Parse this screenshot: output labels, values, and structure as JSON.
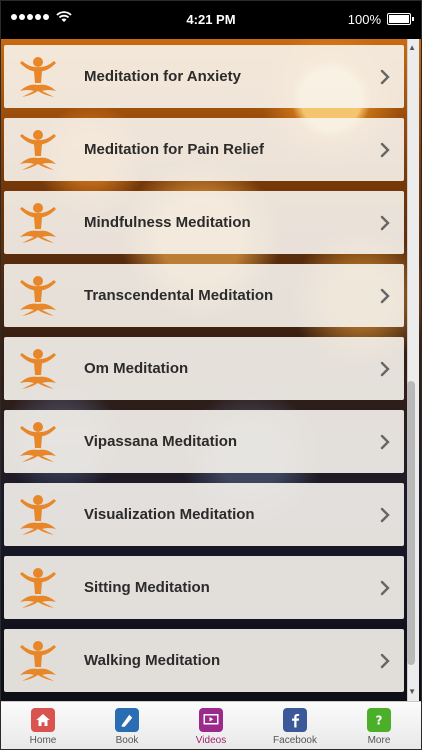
{
  "status_bar": {
    "time": "4:21 PM",
    "battery": "100%",
    "battery_level": 1.0,
    "signal_dots": 5
  },
  "list": {
    "items": [
      {
        "label": "Meditation for Anxiety",
        "icon": "meditation-logo-icon"
      },
      {
        "label": "Meditation for Pain Relief",
        "icon": "meditation-logo-icon"
      },
      {
        "label": "Mindfulness Meditation",
        "icon": "meditation-logo-icon"
      },
      {
        "label": "Transcendental Meditation",
        "icon": "meditation-logo-icon"
      },
      {
        "label": "Om Meditation",
        "icon": "meditation-logo-icon"
      },
      {
        "label": "Vipassana Meditation",
        "icon": "meditation-logo-icon"
      },
      {
        "label": "Visualization Meditation",
        "icon": "meditation-logo-icon"
      },
      {
        "label": "Sitting Meditation",
        "icon": "meditation-logo-icon"
      },
      {
        "label": "Walking Meditation",
        "icon": "meditation-logo-icon"
      }
    ]
  },
  "scrollbar": {
    "position_fraction": 0.55,
    "visible_fraction": 0.45
  },
  "tab_bar": {
    "tabs": [
      {
        "label": "Home",
        "icon": "home-icon",
        "color": "#d9534f",
        "active": false
      },
      {
        "label": "Book",
        "icon": "book-icon",
        "color": "#2a6db3",
        "active": false
      },
      {
        "label": "Videos",
        "icon": "videos-icon",
        "color": "#9b2a8c",
        "active": true
      },
      {
        "label": "Facebook",
        "icon": "facebook-icon",
        "color": "#3b5998",
        "active": false
      },
      {
        "label": "More",
        "icon": "more-icon",
        "color": "#4caf2a",
        "active": false
      }
    ]
  },
  "colors": {
    "logo_orange": "#e8872a",
    "active_tab": "#a0226e"
  }
}
